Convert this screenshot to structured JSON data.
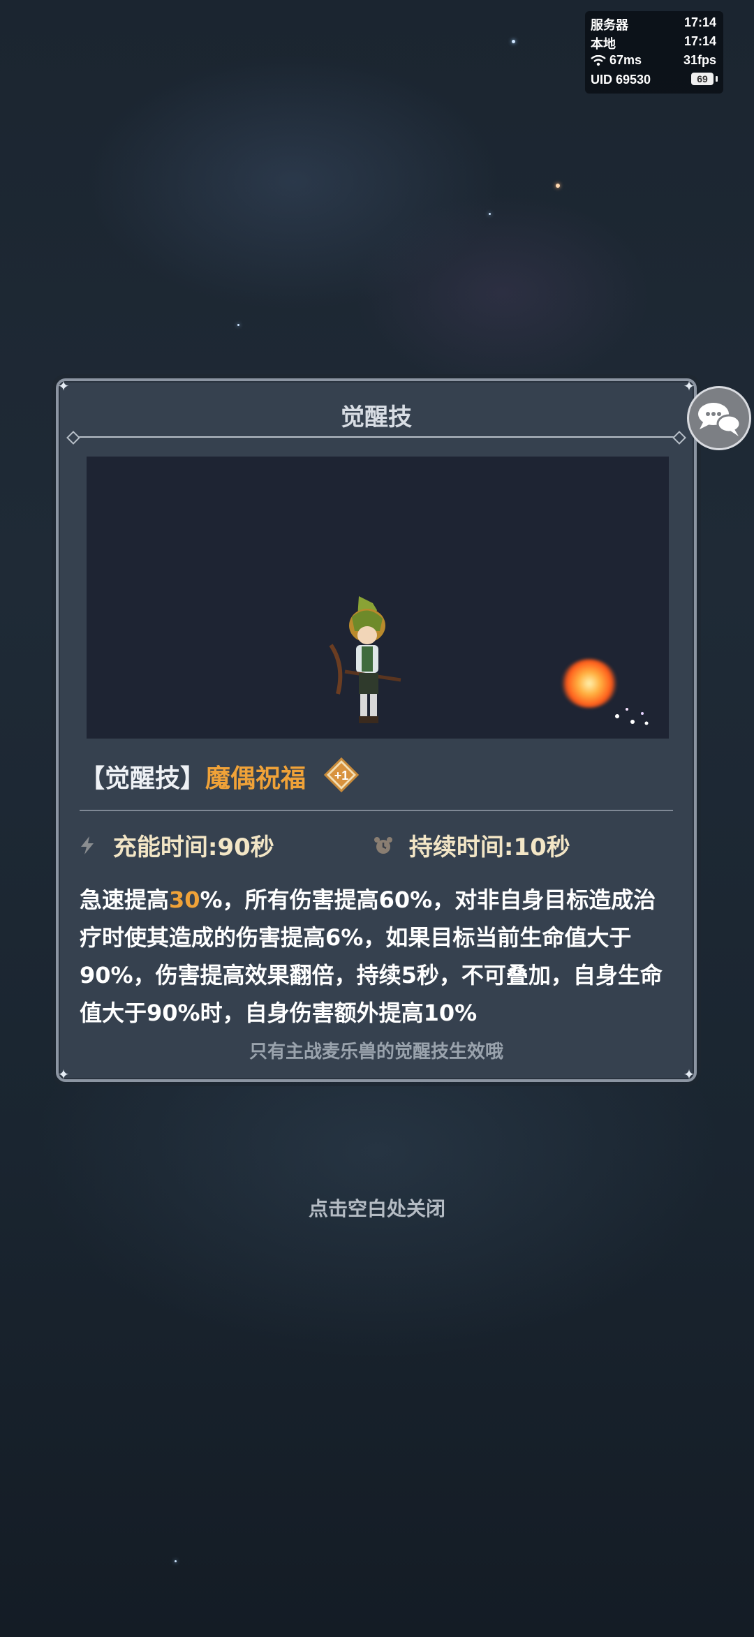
{
  "status": {
    "server_label": "服务器",
    "server_time": "17:14",
    "local_label": "本地",
    "local_time": "17:14",
    "ping": "67ms",
    "fps": "31fps",
    "uid_label": "UID",
    "uid_value": "69530",
    "battery": "69"
  },
  "card": {
    "title": "觉醒技",
    "skill_bracket": "【觉醒技】",
    "skill_name": "魔偶祝福",
    "level_badge": "+1",
    "charge_label": "充能时间:90秒",
    "duration_label": "持续时间:10秒",
    "desc_part1": "急速提高",
    "desc_highlight": "30",
    "desc_part2": "%，所有伤害提高60%，对非自身目标造成治疗时使其造成的伤害提高6%，如果目标当前生命值大于90%，伤害提高效果翻倍，持续5秒，不可叠加，自身生命值大于90%时，自身伤害额外提高10%",
    "note": "只有主战麦乐兽的觉醒技生效哦"
  },
  "close_hint": "点击空白处关闭",
  "colors": {
    "accent": "#f0a238",
    "card_bg": "#36414f",
    "stat_text": "#f3e6c6"
  }
}
